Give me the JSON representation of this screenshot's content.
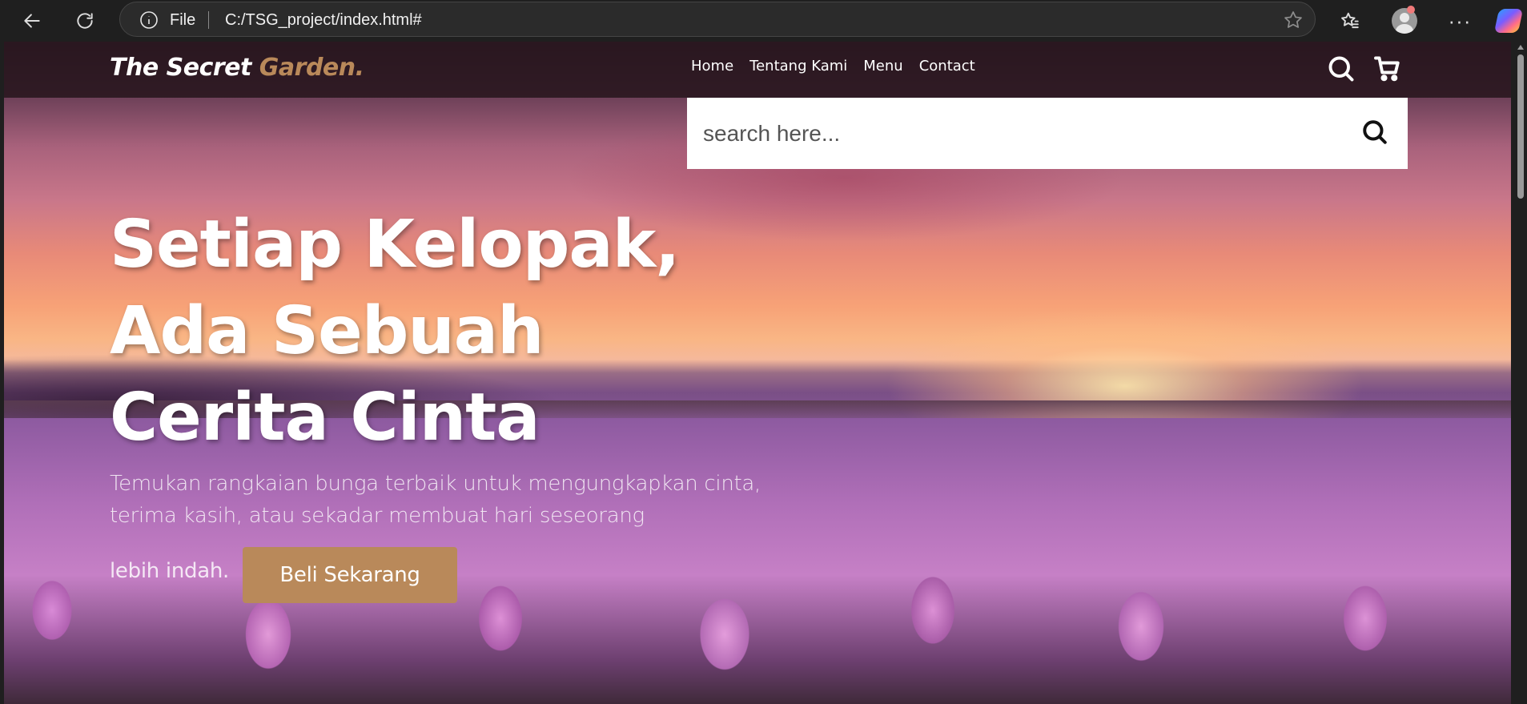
{
  "browser": {
    "scheme_label": "File",
    "url": "C:/TSG_project/index.html#",
    "icons": [
      "back-arrow-icon",
      "refresh-icon",
      "info-icon",
      "star-icon",
      "favorites-icon",
      "profile-avatar-icon",
      "more-dots-icon",
      "copilot-icon"
    ]
  },
  "site": {
    "brand": {
      "primary": "The Secret ",
      "accent": "Garden."
    },
    "nav": [
      "Home",
      "Tentang Kami",
      "Menu",
      "Contact"
    ],
    "icons": [
      "search-icon",
      "cart-icon"
    ]
  },
  "search": {
    "placeholder": "search here...",
    "value": ""
  },
  "hero": {
    "title": "Setiap Kelopak, Ada Sebuah Cerita Cinta",
    "text": "Temukan rangkaian bunga terbaik untuk mengungkapkan cinta, terima kasih, atau sekadar membuat hari seseorang",
    "text_last": "lebih indah.",
    "cta": "Beli Sekarang"
  },
  "colors": {
    "accent": "#b9895a",
    "nav_bg": "#28161e",
    "browser_bg": "#1f1f1f"
  }
}
